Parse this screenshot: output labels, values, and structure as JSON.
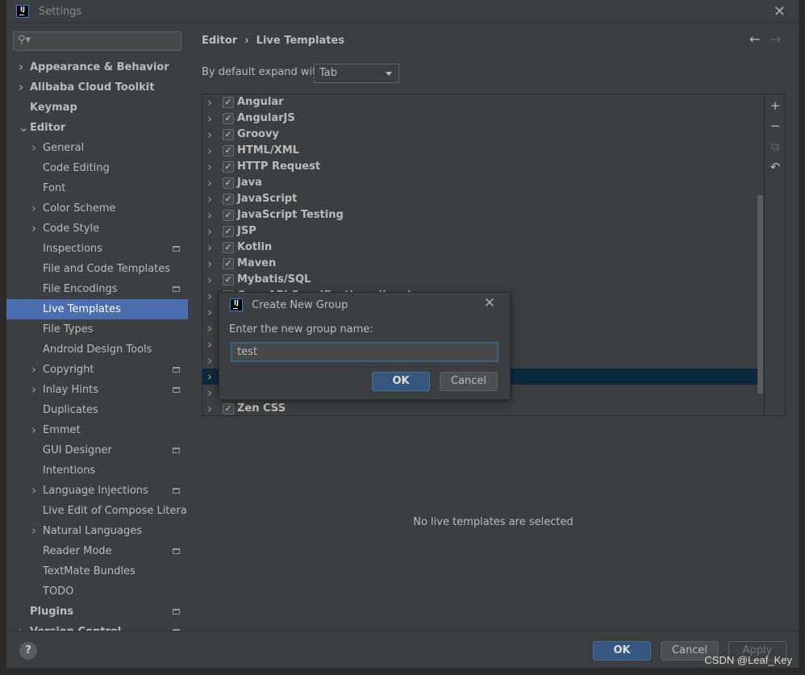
{
  "window": {
    "title": "Settings",
    "logo": "IJ"
  },
  "search": {
    "placeholder": ""
  },
  "sidebar": {
    "items": [
      {
        "label": "Appearance & Behavior",
        "level": 1,
        "bold": true,
        "arrow": ">"
      },
      {
        "label": "Alibaba Cloud Toolkit",
        "level": 1,
        "bold": true,
        "arrow": ">"
      },
      {
        "label": "Keymap",
        "level": 1,
        "bold": true
      },
      {
        "label": "Editor",
        "level": 1,
        "bold": true,
        "arrow": "v"
      },
      {
        "label": "General",
        "level": 2,
        "arrow": ">"
      },
      {
        "label": "Code Editing",
        "level": 2
      },
      {
        "label": "Font",
        "level": 2
      },
      {
        "label": "Color Scheme",
        "level": 2,
        "arrow": ">"
      },
      {
        "label": "Code Style",
        "level": 2,
        "arrow": ">"
      },
      {
        "label": "Inspections",
        "level": 2,
        "cfg": true
      },
      {
        "label": "File and Code Templates",
        "level": 2
      },
      {
        "label": "File Encodings",
        "level": 2,
        "cfg": true
      },
      {
        "label": "Live Templates",
        "level": 2,
        "selected": true
      },
      {
        "label": "File Types",
        "level": 2
      },
      {
        "label": "Android Design Tools",
        "level": 2
      },
      {
        "label": "Copyright",
        "level": 2,
        "arrow": ">",
        "cfg": true
      },
      {
        "label": "Inlay Hints",
        "level": 2,
        "arrow": ">",
        "cfg": true
      },
      {
        "label": "Duplicates",
        "level": 2
      },
      {
        "label": "Emmet",
        "level": 2,
        "arrow": ">"
      },
      {
        "label": "GUI Designer",
        "level": 2,
        "cfg": true
      },
      {
        "label": "Intentions",
        "level": 2
      },
      {
        "label": "Language Injections",
        "level": 2,
        "arrow": ">",
        "cfg": true
      },
      {
        "label": "Live Edit of Compose Literal",
        "level": 2
      },
      {
        "label": "Natural Languages",
        "level": 2,
        "arrow": ">"
      },
      {
        "label": "Reader Mode",
        "level": 2,
        "cfg": true
      },
      {
        "label": "TextMate Bundles",
        "level": 2
      },
      {
        "label": "TODO",
        "level": 2
      },
      {
        "label": "Plugins",
        "level": 1,
        "bold": true,
        "cfg": true
      },
      {
        "label": "Version Control",
        "level": 1,
        "bold": true,
        "arrow": ">",
        "cfg": true
      }
    ]
  },
  "main": {
    "breadcrumb": [
      "Editor",
      "Live Templates"
    ],
    "expand_label": "By default expand with",
    "expand_value": "Tab",
    "groups": [
      {
        "label": "Angular",
        "checked": true
      },
      {
        "label": "AngularJS",
        "checked": true
      },
      {
        "label": "Groovy",
        "checked": true
      },
      {
        "label": "HTML/XML",
        "checked": true
      },
      {
        "label": "HTTP Request",
        "checked": true
      },
      {
        "label": "Java",
        "checked": true
      },
      {
        "label": "JavaScript",
        "checked": true
      },
      {
        "label": "JavaScript Testing",
        "checked": true
      },
      {
        "label": "JSP",
        "checked": true
      },
      {
        "label": "Kotlin",
        "checked": true
      },
      {
        "label": "Maven",
        "checked": true
      },
      {
        "label": "Mybatis/SQL",
        "checked": true
      },
      {
        "label": "OpenAPI Specifications (java)",
        "checked": true
      },
      {
        "label": "",
        "checked": true
      },
      {
        "label": "",
        "checked": true
      },
      {
        "label": "",
        "checked": true
      },
      {
        "label": "",
        "checked": true
      },
      {
        "label": "",
        "checked": true,
        "highlighted": true
      },
      {
        "label": "",
        "checked": true
      },
      {
        "label": "Zen CSS",
        "checked": true
      }
    ],
    "empty_text": "No live templates are selected"
  },
  "dialog": {
    "title": "Create New Group",
    "prompt": "Enter the new group name:",
    "value": "test",
    "ok": "OK",
    "cancel": "Cancel"
  },
  "footer": {
    "help": "?",
    "ok": "OK",
    "cancel": "Cancel",
    "apply": "Apply"
  },
  "watermark": "CSDN @Leaf_Key"
}
